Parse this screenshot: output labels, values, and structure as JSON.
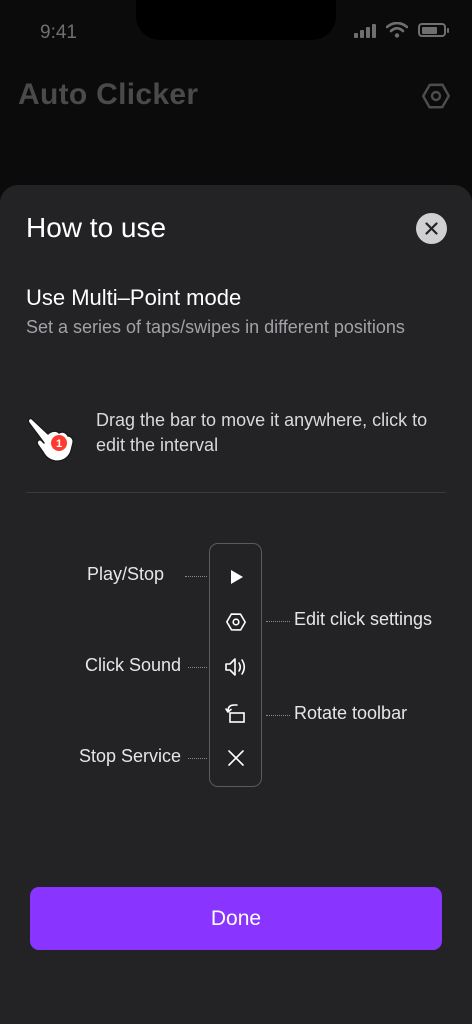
{
  "status_bar": {
    "time": "9:41",
    "icons": [
      "signal-icon",
      "wifi-icon",
      "battery-icon"
    ]
  },
  "app": {
    "title": "Auto Clicker",
    "settings_icon": "hexagon-settings-icon"
  },
  "sheet": {
    "title": "How to use",
    "close_icon": "close-icon",
    "mode_title": "Use Multi–Point mode",
    "mode_description": "Set a series of taps/swipes in different positions",
    "drag_hint": "Drag the bar to move it anywhere, click to edit the interval",
    "hand_badge": "1",
    "toolbar": {
      "icons": [
        "play-icon",
        "hexagon-settings-icon",
        "speaker-icon",
        "rotate-icon",
        "close-icon"
      ],
      "labels": {
        "play_stop": "Play/Stop",
        "edit_settings": "Edit click settings",
        "click_sound": "Click Sound",
        "rotate": "Rotate toolbar",
        "stop_service": "Stop Service"
      }
    },
    "done_label": "Done"
  },
  "colors": {
    "accent": "#8a34ff",
    "sheet_bg": "#232326",
    "badge": "#ff3b30"
  }
}
